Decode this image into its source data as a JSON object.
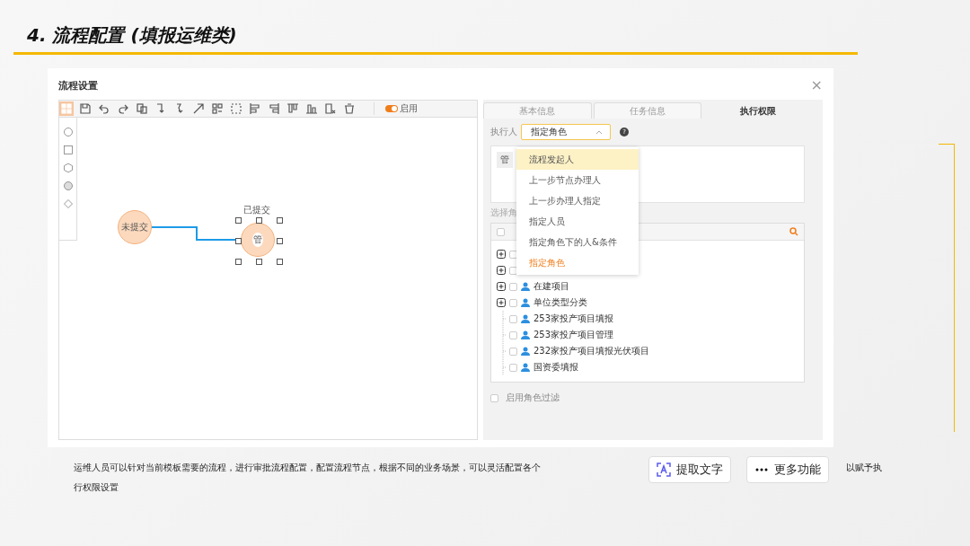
{
  "slide": {
    "title": "4. 流程配置 (填报运维类)"
  },
  "window": {
    "title": "流程设置",
    "close": "×"
  },
  "toolbar": {
    "tools": [
      {
        "selected": true
      },
      {
        "selected": false
      },
      {
        "selected": false
      },
      {
        "selected": false
      },
      {
        "selected": false
      },
      {
        "selected": false
      },
      {
        "selected": false
      },
      {
        "selected": false
      },
      {
        "selected": false
      },
      {
        "selected": false
      },
      {
        "selected": false
      },
      {
        "selected": false
      },
      {
        "selected": false
      },
      {
        "selected": false
      },
      {
        "selected": false
      },
      {
        "selected": false
      }
    ],
    "toggle": {
      "label": "启用",
      "on": true
    }
  },
  "canvas": {
    "nodes": [
      {
        "label": "未提交",
        "selected": false
      },
      {
        "label": "管",
        "caption": "已提交",
        "selected": true
      }
    ]
  },
  "tabs": [
    {
      "label": "基本信息",
      "selected": false
    },
    {
      "label": "任务信息",
      "selected": false
    },
    {
      "label": "执行权限",
      "selected": true
    }
  ],
  "executor": {
    "label": "执行人",
    "value": "指定角色",
    "help": "?"
  },
  "selected_roles": [
    {
      "label": "管"
    }
  ],
  "role_picker": {
    "label": "选择角",
    "all_checked": false,
    "rows": [
      {
        "kind": "group",
        "checked": false
      },
      {
        "kind": "group",
        "checked": false
      },
      {
        "kind": "group",
        "label": "在建项目",
        "checked": false
      },
      {
        "kind": "group",
        "label": "单位类型分类",
        "checked": false
      },
      {
        "kind": "leaf",
        "label": "253家投产项目填报",
        "checked": false
      },
      {
        "kind": "leaf",
        "label": "253家投产项目管理",
        "checked": false
      },
      {
        "kind": "leaf",
        "label": "232家投产项目填报光伏项目",
        "checked": false
      },
      {
        "kind": "leaf",
        "label": "国资委填报",
        "checked": false
      }
    ]
  },
  "role_filter": {
    "label": "启用角色过滤",
    "checked": false
  },
  "dropdown": [
    {
      "label": "流程发起人",
      "hovered": true,
      "selected": false
    },
    {
      "label": "上一步节点办理人",
      "hovered": false,
      "selected": false
    },
    {
      "label": "上一步办理人指定",
      "hovered": false,
      "selected": false
    },
    {
      "label": "指定人员",
      "hovered": false,
      "selected": false
    },
    {
      "label": "指定角色下的人&条件",
      "hovered": false,
      "selected": false
    },
    {
      "label": "指定角色",
      "hovered": false,
      "selected": true
    }
  ],
  "description": [
    "运维人员可以针对当前模板需要的流程，进行审批流程配置，配置流程节点，根据不同的业务场景，可以灵活配置各个",
    "以赋予执",
    "行权限设置"
  ],
  "viewer_buttons": [
    {
      "label": "提取文字",
      "kind": "extract"
    },
    {
      "label": "更多功能",
      "kind": "more"
    }
  ]
}
